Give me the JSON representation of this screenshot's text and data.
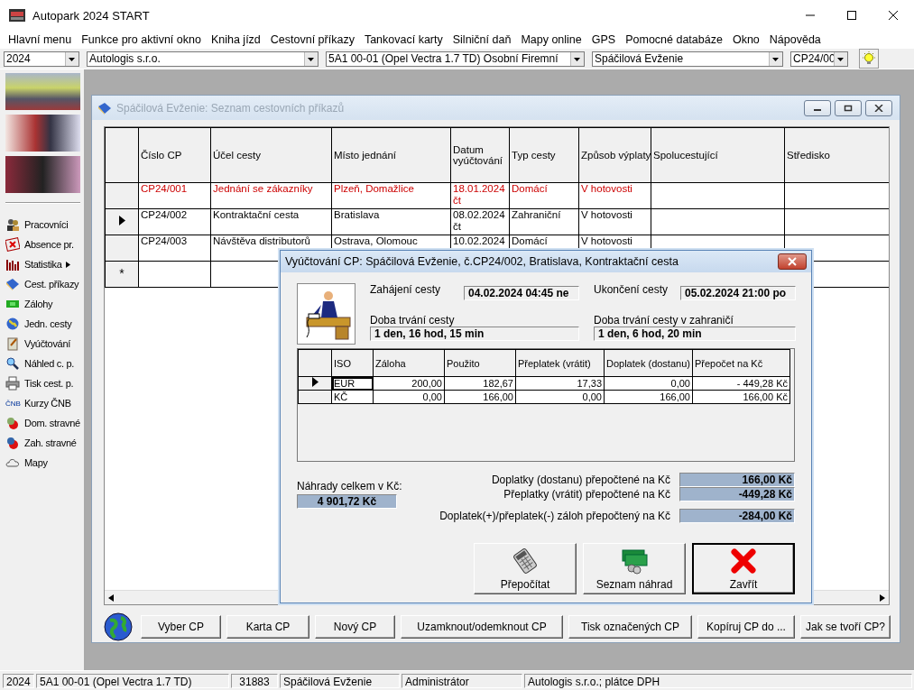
{
  "window": {
    "title": "Autopark 2024 START"
  },
  "menu": [
    "Hlavní menu",
    "Funkce pro aktivní okno",
    "Kniha jízd",
    "Cestovní příkazy",
    "Tankovací karty",
    "Silniční daň",
    "Mapy online",
    "GPS",
    "Pomocné databáze",
    "Okno",
    "Nápověda"
  ],
  "toolbar": {
    "combos": [
      {
        "value": "2024"
      },
      {
        "value": "Autologis s.r.o."
      },
      {
        "value": "5A1 00-01 (Opel Vectra 1.7 TD) Osobní Firemní"
      },
      {
        "value": "Spáčilová Evženie"
      },
      {
        "value": "CP24/00"
      }
    ]
  },
  "sidebar": {
    "items": [
      {
        "label": "Pracovníci",
        "submenu": false
      },
      {
        "label": "Absence pr.",
        "submenu": false
      },
      {
        "label": "Statistika",
        "submenu": true
      },
      {
        "label": "Cest. příkazy",
        "submenu": false
      },
      {
        "label": "Zálohy",
        "submenu": false
      },
      {
        "label": "Jedn. cesty",
        "submenu": false
      },
      {
        "label": "Vyúčtování",
        "submenu": false
      },
      {
        "label": "Náhled c. p.",
        "submenu": false
      },
      {
        "label": "Tisk cest. p.",
        "submenu": false
      },
      {
        "label": "Kurzy ČNB",
        "submenu": false,
        "icon_text": "ČNB"
      },
      {
        "label": "Dom. stravné",
        "submenu": false
      },
      {
        "label": "Zah. stravné",
        "submenu": false
      },
      {
        "label": "Mapy",
        "submenu": false
      }
    ]
  },
  "child_window": {
    "title": "Spáčilová Evženie: Seznam cestovních příkazů",
    "table": {
      "columns": [
        "Číslo CP",
        "Účel cesty",
        "Místo jednání",
        "Datum vyúčtování",
        "Typ cesty",
        "Způsob výplaty",
        "Spolucestující",
        "Středisko"
      ],
      "rows": [
        {
          "selected": false,
          "color": "#cc0000",
          "cells": [
            "CP24/001",
            "Jednání se zákazníky",
            "Plzeň, Domažlice",
            "18.01.2024 čt",
            "Domácí",
            "V hotovosti",
            "",
            ""
          ]
        },
        {
          "selected": true,
          "color": "#000000",
          "cells": [
            "CP24/002",
            "Kontraktační cesta",
            "Bratislava",
            "08.02.2024 čt",
            "Zahraniční",
            "V hotovosti",
            "",
            ""
          ]
        },
        {
          "selected": false,
          "color": "#000000",
          "cells": [
            "CP24/003",
            "Návštěva distributorů",
            "Ostrava, Olomouc",
            "10.02.2024",
            "Domácí",
            "V hotovosti",
            "",
            ""
          ]
        }
      ],
      "new_row_marker": "*"
    },
    "buttons": [
      "Vyber CP",
      "Karta CP",
      "Nový CP",
      "Uzamknout/odemknout CP",
      "Tisk označených CP",
      "Kopíruj CP do ...",
      "Jak se tvoří CP?"
    ]
  },
  "dialog": {
    "title": "Vyúčtování CP: Spáčilová Evženie, č.CP24/002, Bratislava, Kontraktační cesta",
    "start": {
      "label": "Zahájení cesty",
      "value": "04.02.2024 04:45 ne"
    },
    "end": {
      "label": "Ukončení cesty",
      "value": "05.02.2024 21:00 po"
    },
    "duration": {
      "label": "Doba trvání cesty",
      "value": "1 den, 16 hod, 15 min"
    },
    "duration_abroad": {
      "label": "Doba trvání cesty v zahraničí",
      "value": "1 den, 6 hod, 20 min"
    },
    "grid": {
      "columns": [
        "ISO",
        "Záloha",
        "Použito",
        "Přeplatek (vrátit)",
        "Doplatek (dostanu)",
        "Přepočet na Kč"
      ],
      "rows": [
        {
          "selected": true,
          "cells": [
            "EUR",
            "200,00",
            "182,67",
            "17,33",
            "0,00",
            "- 449,28 Kč"
          ]
        },
        {
          "selected": false,
          "cells": [
            "KČ",
            "0,00",
            "166,00",
            "0,00",
            "166,00",
            "166,00 Kč"
          ]
        }
      ]
    },
    "total": {
      "label": "Náhrady celkem v Kč:",
      "value": "4 901,72 Kč"
    },
    "summary": [
      {
        "label": "Doplatky (dostanu) přepočtené na Kč",
        "value": "166,00 Kč"
      },
      {
        "label": "Přeplatky (vrátit) přepočtené na Kč",
        "value": "-449,28 Kč"
      },
      {
        "label": "Doplatek(+)/přeplatek(-) záloh přepočtený na Kč",
        "value": "-284,00 Kč"
      }
    ],
    "buttons": [
      {
        "kind": "calculator",
        "label": "Přepočítat",
        "default": false
      },
      {
        "kind": "money",
        "label": "Seznam náhrad",
        "default": false
      },
      {
        "kind": "close",
        "label": "Zavřít",
        "default": true
      }
    ]
  },
  "status_bar": [
    "2024",
    "5A1 00-01 (Opel Vectra 1.7 TD)",
    "31883",
    "Spáčilová Evženie",
    "Administrátor",
    "Autologis s.r.o.;  plátce DPH"
  ]
}
